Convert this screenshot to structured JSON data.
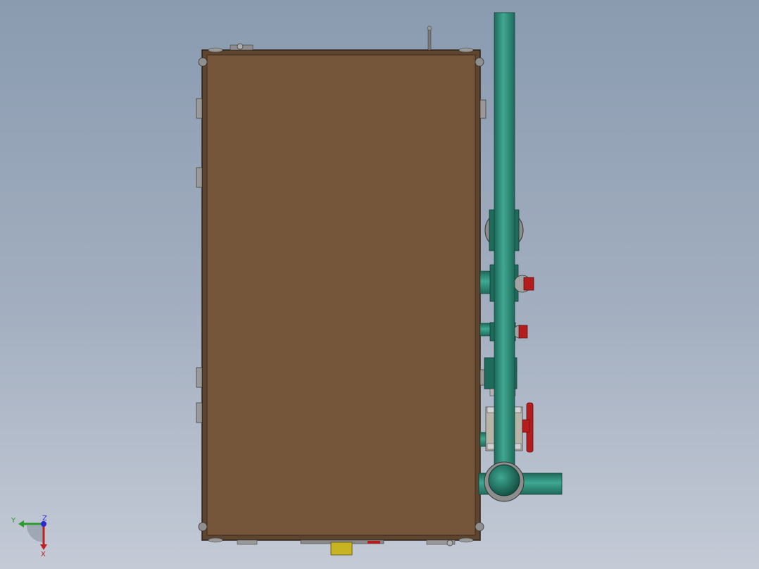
{
  "viewport": {
    "background_top": "#8a9bb0",
    "background_bottom": "#c4cad6"
  },
  "model": {
    "cabinet_color": "#76563b",
    "cabinet_edge_color": "#3a2a1c",
    "pipe_color": "#2f8f7c",
    "pipe_dark_color": "#1f6b5b",
    "valve_red": "#b41d1d",
    "flange_grey": "#a0a0a0",
    "bracket_yellow": "#c8b422"
  },
  "triad": {
    "y_label": "Y",
    "z_label": "Z",
    "x_label": "X",
    "y_color": "#2a9a2a",
    "z_color": "#2a2ad0",
    "x_color": "#c02020"
  }
}
